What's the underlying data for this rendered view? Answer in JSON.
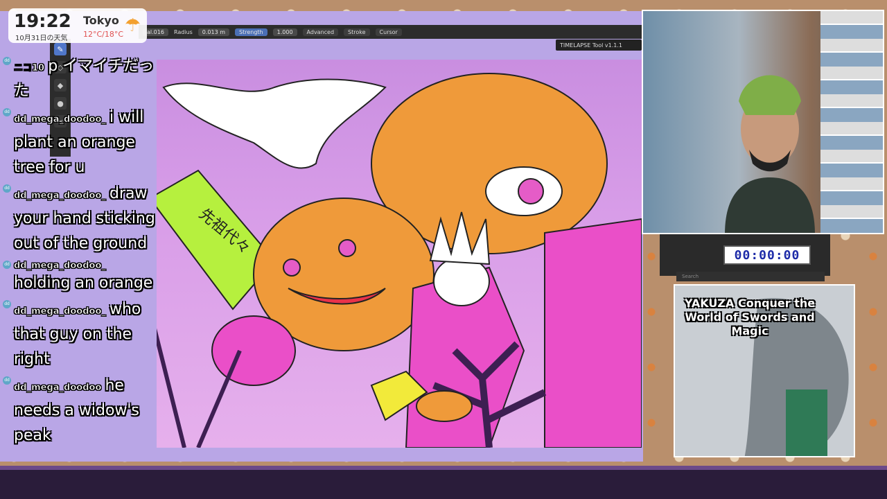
{
  "clock": {
    "time": "19:22",
    "city": "Tokyo",
    "date": "10月31日の天気",
    "temps": "12°C/18°C",
    "weather_icon": "rain-cloud-icon"
  },
  "app": {
    "layer_field": "al.016",
    "radius_label": "Radius",
    "radius_value": "0.013 m",
    "strength_label": "Strength",
    "strength_value": "1.000",
    "menu_advanced": "Advanced",
    "menu_stroke": "Stroke",
    "menu_cursor": "Cursor",
    "timelapse": "TIMELAPSE Tool v1.1.1",
    "tools": [
      "draw-tool-icon",
      "erase-tool-icon",
      "fill-tool-icon",
      "tint-tool-icon",
      "cutter-tool-icon"
    ]
  },
  "chat": [
    {
      "user": "ニコ10",
      "text": "p イマイチだった"
    },
    {
      "user": "dd_mega_doodoo_",
      "text": "i will plant an orange tree for u"
    },
    {
      "user": "dd_mega_doodoo_",
      "text": "draw your hand sticking out of the ground"
    },
    {
      "user": "dd_mega_doodoo_",
      "text": "holding an orange"
    },
    {
      "user": "dd_mega_doodoo_",
      "text": "who that guy on the right"
    },
    {
      "user": "dd_mega_doodoo",
      "text": "he needs a widow's peak"
    }
  ],
  "art": {
    "gravestone_text": "先祖代々"
  },
  "timer": {
    "value": "00:00:00"
  },
  "search": {
    "placeholder": "Search"
  },
  "book": {
    "title": "YAKUZA Conquer the World of Swords and Magic"
  },
  "colors": {
    "accent_blue": "#4b6fb5",
    "canvas_pink": "#d89de8",
    "pumpkin": "#ef9a3a",
    "lime": "#b6f03e"
  }
}
